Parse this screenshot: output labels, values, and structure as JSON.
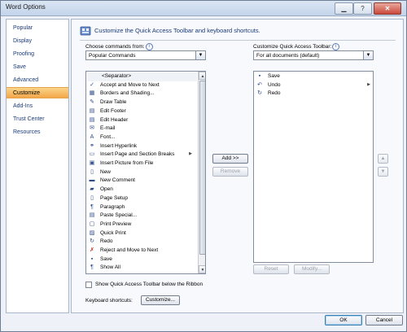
{
  "window": {
    "title": "Word Options",
    "minimize": "▁",
    "maximize": "?",
    "close": "✕"
  },
  "sidebar": {
    "items": [
      {
        "label": "Popular",
        "active": false
      },
      {
        "label": "Display",
        "active": false
      },
      {
        "label": "Proofing",
        "active": false
      },
      {
        "label": "Save",
        "active": false
      },
      {
        "label": "Advanced",
        "active": false
      },
      {
        "label": "Customize",
        "active": true
      },
      {
        "label": "Add-Ins",
        "active": false
      },
      {
        "label": "Trust Center",
        "active": false
      },
      {
        "label": "Resources",
        "active": false
      }
    ]
  },
  "header": {
    "text": "Customize the Quick Access Toolbar and keyboard shortcuts."
  },
  "left_panel": {
    "label": "Choose commands from:",
    "info": "i",
    "combo_value": "Popular Commands",
    "commands": [
      {
        "label": "<Separator>",
        "icon": "",
        "submenu": false
      },
      {
        "label": "Accept and Move to Next",
        "icon": "✓",
        "submenu": false
      },
      {
        "label": "Borders and Shading...",
        "icon": "▦",
        "submenu": false
      },
      {
        "label": "Draw Table",
        "icon": "✎",
        "submenu": false
      },
      {
        "label": "Edit Footer",
        "icon": "▤",
        "submenu": false
      },
      {
        "label": "Edit Header",
        "icon": "▤",
        "submenu": false
      },
      {
        "label": "E-mail",
        "icon": "✉",
        "submenu": false
      },
      {
        "label": "Font...",
        "icon": "A",
        "submenu": false
      },
      {
        "label": "Insert Hyperlink",
        "icon": "⚭",
        "submenu": false
      },
      {
        "label": "Insert Page and Section Breaks",
        "icon": "▭",
        "submenu": true
      },
      {
        "label": "Insert Picture from File",
        "icon": "▣",
        "submenu": false
      },
      {
        "label": "New",
        "icon": "▯",
        "submenu": false
      },
      {
        "label": "New Comment",
        "icon": "▬",
        "submenu": false
      },
      {
        "label": "Open",
        "icon": "▰",
        "submenu": false
      },
      {
        "label": "Page Setup",
        "icon": "▯",
        "submenu": false
      },
      {
        "label": "Paragraph",
        "icon": "¶",
        "submenu": false
      },
      {
        "label": "Paste Special...",
        "icon": "▤",
        "submenu": false
      },
      {
        "label": "Print Preview",
        "icon": "▢",
        "submenu": false
      },
      {
        "label": "Quick Print",
        "icon": "▨",
        "submenu": false
      },
      {
        "label": "Redo",
        "icon": "↻",
        "submenu": false
      },
      {
        "label": "Reject and Move to Next",
        "icon": "✗",
        "submenu": false
      },
      {
        "label": "Save",
        "icon": "▪",
        "submenu": false
      },
      {
        "label": "Show All",
        "icon": "¶",
        "submenu": false
      }
    ]
  },
  "middle": {
    "add_label": "Add >>",
    "remove_label": "Remove"
  },
  "right_panel": {
    "label": "Customize Quick Access Toolbar:",
    "info": "i",
    "combo_value": "For all documents (default)",
    "items": [
      {
        "label": "Save",
        "icon": "▪",
        "submenu": false
      },
      {
        "label": "Undo",
        "icon": "↶",
        "submenu": true
      },
      {
        "label": "Redo",
        "icon": "↻",
        "submenu": false
      }
    ],
    "reset_label": "Reset",
    "modify_label": "Modify...",
    "move_up": "▲",
    "move_down": "▼"
  },
  "bottom": {
    "show_below_label": "Show Quick Access Toolbar below the Ribbon",
    "keyboard_label": "Keyboard shortcuts:",
    "customize_label": "Customize..."
  },
  "footer": {
    "ok_label": "OK",
    "cancel_label": "Cancel"
  },
  "colors": {
    "accent": "#f4a64a",
    "link": "#1b3a78"
  }
}
